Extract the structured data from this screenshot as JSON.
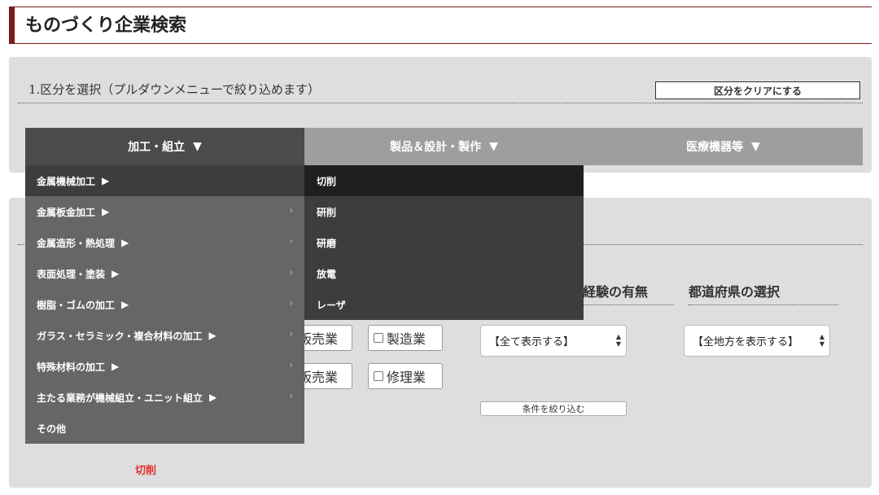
{
  "header": {
    "title": "ものづくり企業検索"
  },
  "step1": {
    "heading": "1.区分を選択（プルダウンメニューで絞り込めます）",
    "clear_label": "区分をクリアにする"
  },
  "tabs": [
    {
      "label": "加工・組立"
    },
    {
      "label": "製品＆設計・製作"
    },
    {
      "label": "医療機器等"
    }
  ],
  "menu": {
    "items": [
      {
        "label": "金属機械加工",
        "has_sub": true
      },
      {
        "label": "金属板金加工",
        "has_sub": true
      },
      {
        "label": "金属造形・熱処理",
        "has_sub": true
      },
      {
        "label": "表面処理・塗装",
        "has_sub": true
      },
      {
        "label": "樹脂・ゴムの加工",
        "has_sub": true
      },
      {
        "label": "ガラス・セラミック・複合材料の加工",
        "has_sub": true
      },
      {
        "label": "特殊材料の加工",
        "has_sub": true
      },
      {
        "label": "主たる業務が機械組立・ユニット組立",
        "has_sub": true
      },
      {
        "label": "その他",
        "has_sub": false
      }
    ],
    "sub_items": [
      {
        "label": "切削"
      },
      {
        "label": "研削"
      },
      {
        "label": "研磨"
      },
      {
        "label": "放電"
      },
      {
        "label": "レーザ"
      }
    ]
  },
  "step2": {
    "business": {
      "btn_a": "販売業",
      "btn_b": "販売業",
      "manufacture": "製造業",
      "repair": "修理業"
    },
    "experience_heading": "る経験の有無",
    "pref_heading": "都道府県の選択",
    "experience_select": "【全て表示する】",
    "pref_select": "【全地方を表示する】",
    "filter_label": "条件を絞り込む"
  },
  "selected": {
    "label": "切削"
  }
}
